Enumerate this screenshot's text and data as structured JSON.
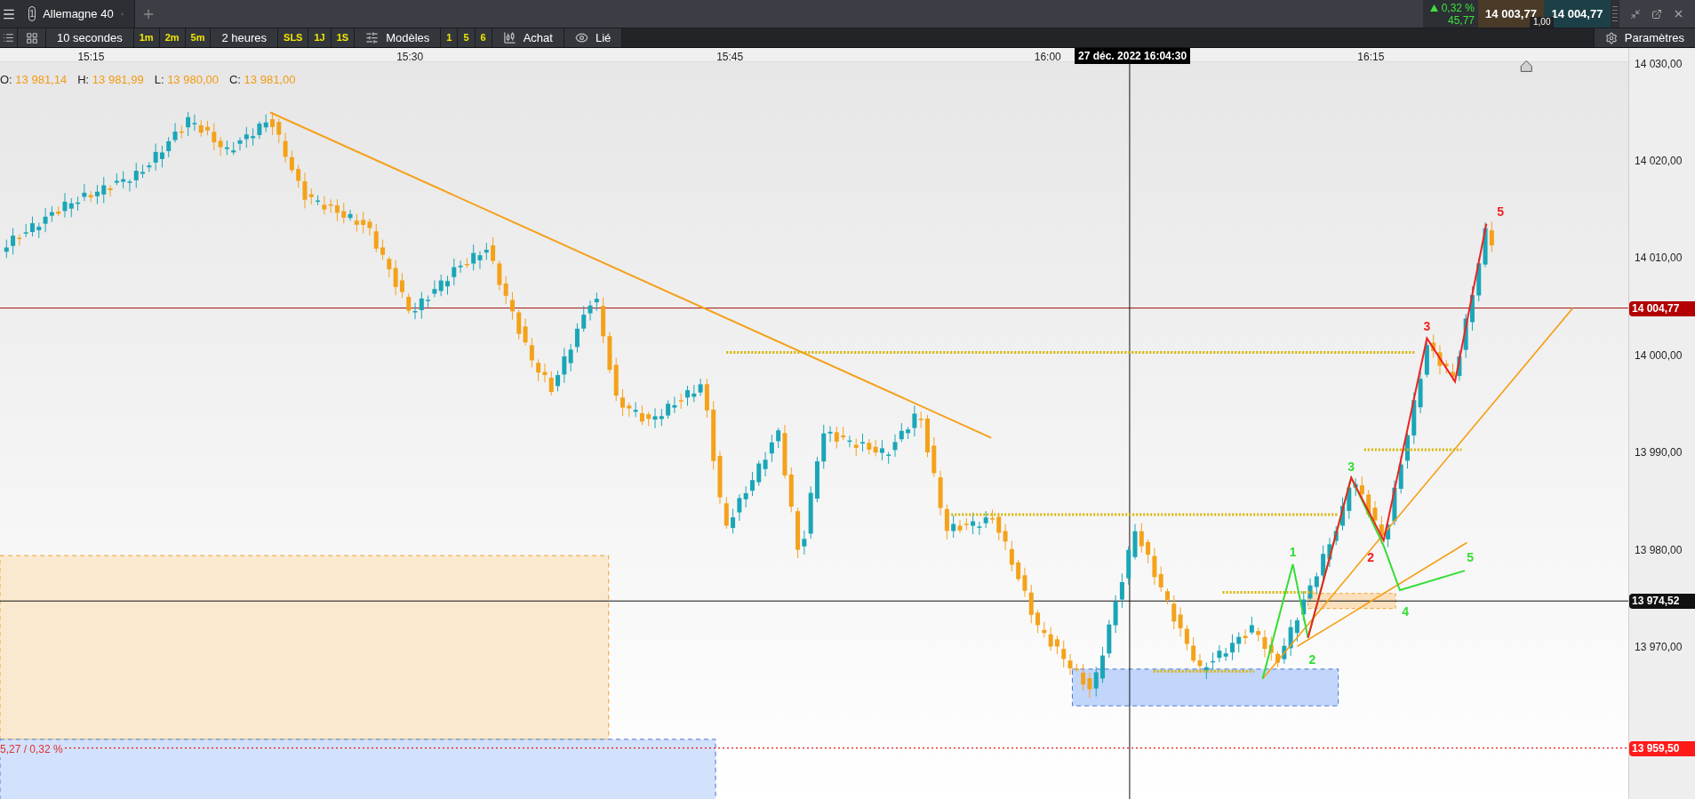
{
  "top_bar": {
    "tab": {
      "number": "1",
      "title": "Allemagne 40"
    },
    "change": {
      "rising": true,
      "percent": "0,32 %",
      "points": "45,77"
    },
    "bid": "14 003,77",
    "ask": "14 004,77",
    "spread": "1,00"
  },
  "toolbar": {
    "items": [
      {
        "kind": "select",
        "label": "10 secondes"
      },
      {
        "kind": "quick",
        "label": "1m"
      },
      {
        "kind": "quick",
        "label": "2m"
      },
      {
        "kind": "quick",
        "label": "5m"
      },
      {
        "kind": "select",
        "label": "2 heures"
      },
      {
        "kind": "quick",
        "label": "SLS"
      },
      {
        "kind": "quick",
        "label": "1J"
      },
      {
        "kind": "quick",
        "label": "1S"
      },
      {
        "kind": "templates",
        "label": "Modèles"
      },
      {
        "kind": "quick",
        "label": "1"
      },
      {
        "kind": "quick",
        "label": "5"
      },
      {
        "kind": "quick",
        "label": "6"
      },
      {
        "kind": "buy",
        "label": "Achat"
      },
      {
        "kind": "linked",
        "label": "Lié"
      }
    ],
    "settings": "Paramètres"
  },
  "time_axis": {
    "labels": [
      "15:15",
      "15:30",
      "15:45",
      "16:00",
      "16:15"
    ],
    "crosshair": "27 déc. 2022 16:04:30"
  },
  "ohlc": [
    {
      "label": "O:",
      "value": "13 981,14"
    },
    {
      "label": "H:",
      "value": "13 981,99"
    },
    {
      "label": "L:",
      "value": "13 980,00"
    },
    {
      "label": "C:",
      "value": "13 981,00"
    }
  ],
  "price_axis": {
    "ticks": [
      "14 030,00",
      "14 020,00",
      "14 010,00",
      "14 000,00",
      "13 990,00",
      "13 980,00",
      "13 970,00"
    ],
    "markers": [
      {
        "kind": "last",
        "value": "14 004,77"
      },
      {
        "kind": "crosshair",
        "value": "13 974,52"
      },
      {
        "kind": "alert",
        "value": "13 959,50"
      }
    ]
  },
  "alert_note": "5,27 / 0,32 %",
  "waves": [
    {
      "color": "#33dd33",
      "labels": [
        "1",
        "2",
        "3",
        "4",
        "5"
      ]
    },
    {
      "color": "#ee2222",
      "labels": [
        "2",
        "3",
        "5"
      ]
    }
  ]
}
